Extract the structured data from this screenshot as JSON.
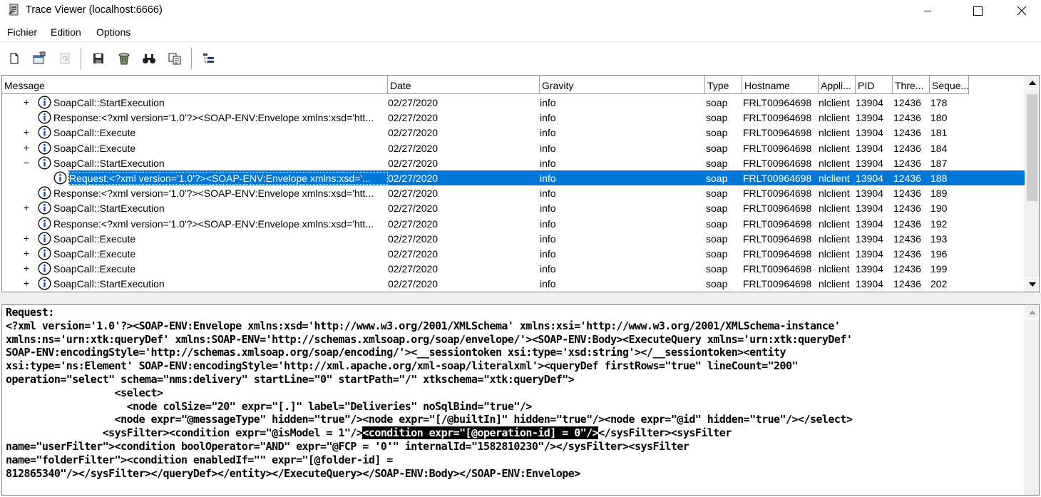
{
  "window": {
    "title": "Trace Viewer (localhost:6666)",
    "icon": "trace-viewer-app-icon"
  },
  "menu": [
    "Fichier",
    "Edition",
    "Options"
  ],
  "toolbar": {
    "buttons": [
      "new-file-icon",
      "properties-icon",
      "refresh-icon",
      "save-icon",
      "clear-icon",
      "find-icon",
      "copy-icon",
      "tree-view-icon"
    ]
  },
  "columns": [
    "Message",
    "Date",
    "Gravity",
    "Type",
    "Hostname",
    "Appli...",
    "PID",
    "Thre...",
    "Seque..."
  ],
  "rows": [
    {
      "expander": "+",
      "message": "SoapCall::StartExecution",
      "date": "02/27/2020",
      "gravity": "info",
      "type": "soap",
      "hostname": "FRLT00964698",
      "appli": "nlclient",
      "pid": "13904",
      "thread": "12436",
      "seq": "178"
    },
    {
      "expander": "",
      "message": "Response:<?xml version='1.0'?><SOAP-ENV:Envelope xmlns:xsd='htt...",
      "date": "02/27/2020",
      "gravity": "info",
      "type": "soap",
      "hostname": "FRLT00964698",
      "appli": "nlclient",
      "pid": "13904",
      "thread": "12436",
      "seq": "180"
    },
    {
      "expander": "+",
      "message": "SoapCall::Execute",
      "date": "02/27/2020",
      "gravity": "info",
      "type": "soap",
      "hostname": "FRLT00964698",
      "appli": "nlclient",
      "pid": "13904",
      "thread": "12436",
      "seq": "181"
    },
    {
      "expander": "+",
      "message": "SoapCall::Execute",
      "date": "02/27/2020",
      "gravity": "info",
      "type": "soap",
      "hostname": "FRLT00964698",
      "appli": "nlclient",
      "pid": "13904",
      "thread": "12436",
      "seq": "184"
    },
    {
      "expander": "−",
      "message": "SoapCall::StartExecution",
      "date": "02/27/2020",
      "gravity": "info",
      "type": "soap",
      "hostname": "FRLT00964698",
      "appli": "nlclient",
      "pid": "13904",
      "thread": "12436",
      "seq": "187"
    },
    {
      "expander": "",
      "child": true,
      "selected": true,
      "message": "Request:<?xml version='1.0'?><SOAP-ENV:Envelope xmlns:xsd='...",
      "date": "02/27/2020",
      "gravity": "info",
      "type": "soap",
      "hostname": "FRLT00964698",
      "appli": "nlclient",
      "pid": "13904",
      "thread": "12436",
      "seq": "188"
    },
    {
      "expander": "",
      "message": "Response:<?xml version='1.0'?><SOAP-ENV:Envelope xmlns:xsd='htt...",
      "date": "02/27/2020",
      "gravity": "info",
      "type": "soap",
      "hostname": "FRLT00964698",
      "appli": "nlclient",
      "pid": "13904",
      "thread": "12436",
      "seq": "189"
    },
    {
      "expander": "+",
      "message": "SoapCall::StartExecution",
      "date": "02/27/2020",
      "gravity": "info",
      "type": "soap",
      "hostname": "FRLT00964698",
      "appli": "nlclient",
      "pid": "13904",
      "thread": "12436",
      "seq": "190"
    },
    {
      "expander": "",
      "message": "Response:<?xml version='1.0'?><SOAP-ENV:Envelope xmlns:xsd='htt...",
      "date": "02/27/2020",
      "gravity": "info",
      "type": "soap",
      "hostname": "FRLT00964698",
      "appli": "nlclient",
      "pid": "13904",
      "thread": "12436",
      "seq": "192"
    },
    {
      "expander": "+",
      "message": "SoapCall::Execute",
      "date": "02/27/2020",
      "gravity": "info",
      "type": "soap",
      "hostname": "FRLT00964698",
      "appli": "nlclient",
      "pid": "13904",
      "thread": "12436",
      "seq": "193"
    },
    {
      "expander": "+",
      "message": "SoapCall::Execute",
      "date": "02/27/2020",
      "gravity": "info",
      "type": "soap",
      "hostname": "FRLT00964698",
      "appli": "nlclient",
      "pid": "13904",
      "thread": "12436",
      "seq": "196"
    },
    {
      "expander": "+",
      "message": "SoapCall::Execute",
      "date": "02/27/2020",
      "gravity": "info",
      "type": "soap",
      "hostname": "FRLT00964698",
      "appli": "nlclient",
      "pid": "13904",
      "thread": "12436",
      "seq": "199"
    },
    {
      "expander": "+",
      "message": "SoapCall::StartExecution",
      "date": "02/27/2020",
      "gravity": "info",
      "type": "soap",
      "hostname": "FRLT00964698",
      "appli": "nlclient",
      "pid": "13904",
      "thread": "12436",
      "seq": "202"
    }
  ],
  "detail": {
    "lines": [
      "Request:",
      "<?xml version='1.0'?><SOAP-ENV:Envelope xmlns:xsd='http://www.w3.org/2001/XMLSchema' xmlns:xsi='http://www.w3.org/2001/XMLSchema-instance'",
      "xmlns:ns='urn:xtk:queryDef' xmlns:SOAP-ENV='http://schemas.xmlsoap.org/soap/envelope/'><SOAP-ENV:Body><ExecuteQuery xmlns='urn:xtk:queryDef'",
      "SOAP-ENV:encodingStyle='http://schemas.xmlsoap.org/soap/encoding/'><__sessiontoken xsi:type='xsd:string'></__sessiontoken><entity",
      "xsi:type='ns:Element' SOAP-ENV:encodingStyle='http://xml.apache.org/xml-soap/literalxml'><queryDef firstRows=\"true\" lineCount=\"200\"",
      "operation=\"select\" schema=\"nms:delivery\" startLine=\"0\" startPath=\"/\" xtkschema=\"xtk:queryDef\">",
      "                  <select>",
      "                    <node colSize=\"20\" expr=\"[.]\" label=\"Deliveries\" noSqlBind=\"true\"/>",
      "                  <node expr=\"@messageType\" hidden=\"true\"/><node expr=\"[/@builtIn]\" hidden=\"true\"/><node expr=\"@id\" hidden=\"true\"/></select>"
    ],
    "line9_pre": "                <sysFilter><condition expr=\"@isModel = 1\"/>",
    "line9_highlight": "<condition expr=\"[@operation-id] = 0\"/>",
    "line9_post": "</sysFilter><sysFilter",
    "tail_lines": [
      "name=\"userFilter\"><condition boolOperator=\"AND\" expr=\"@FCP = '0'\" internalId=\"1582810230\"/></sysFilter><sysFilter",
      "name=\"folderFilter\"><condition enabledIf=\"\" expr=\"[@folder-id] =",
      "812865340\"/></sysFilter></queryDef></entity></ExecuteQuery></SOAP-ENV:Body></SOAP-ENV:Envelope>"
    ]
  }
}
